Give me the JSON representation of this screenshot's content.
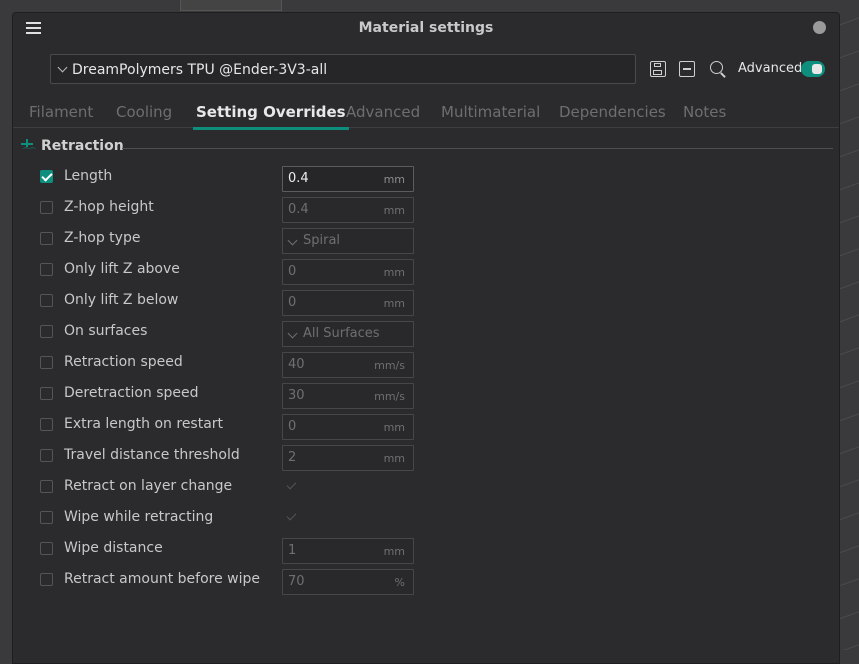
{
  "window": {
    "title": "Material settings"
  },
  "preset": {
    "value": "DreamPolymers  TPU @Ender-3V3-all"
  },
  "toolbar": {
    "advanced_label": "Advanced",
    "advanced_on": true
  },
  "tabs": [
    {
      "label": "Filament",
      "active": false
    },
    {
      "label": "Cooling",
      "active": false
    },
    {
      "label": "Setting Overrides",
      "active": true
    },
    {
      "label": "Advanced",
      "active": false
    },
    {
      "label": "Multimaterial",
      "active": false
    },
    {
      "label": "Dependencies",
      "active": false
    },
    {
      "label": "Notes",
      "active": false
    }
  ],
  "section": {
    "title": "Retraction"
  },
  "rows": [
    {
      "label": "Length",
      "checked": true,
      "kind": "number",
      "value": "0.4",
      "unit": "mm"
    },
    {
      "label": "Z-hop height",
      "checked": false,
      "kind": "number",
      "value": "0.4",
      "unit": "mm"
    },
    {
      "label": "Z-hop type",
      "checked": false,
      "kind": "select",
      "value": "Spiral"
    },
    {
      "label": "Only lift Z above",
      "checked": false,
      "kind": "number",
      "value": "0",
      "unit": "mm"
    },
    {
      "label": "Only lift Z below",
      "checked": false,
      "kind": "number",
      "value": "0",
      "unit": "mm"
    },
    {
      "label": "On surfaces",
      "checked": false,
      "kind": "select",
      "value": "All Surfaces"
    },
    {
      "label": "Retraction speed",
      "checked": false,
      "kind": "number",
      "value": "40",
      "unit": "mm/s"
    },
    {
      "label": "Deretraction speed",
      "checked": false,
      "kind": "number",
      "value": "30",
      "unit": "mm/s"
    },
    {
      "label": "Extra length on restart",
      "checked": false,
      "kind": "number",
      "value": "0",
      "unit": "mm"
    },
    {
      "label": "Travel distance threshold",
      "checked": false,
      "kind": "number",
      "value": "2",
      "unit": "mm"
    },
    {
      "label": "Retract on layer change",
      "checked": false,
      "kind": "bool",
      "value": true
    },
    {
      "label": "Wipe while retracting",
      "checked": false,
      "kind": "bool",
      "value": true
    },
    {
      "label": "Wipe distance",
      "checked": false,
      "kind": "number",
      "value": "1",
      "unit": "mm"
    },
    {
      "label": "Retract amount before wipe",
      "checked": false,
      "kind": "number",
      "value": "70",
      "unit": "%"
    }
  ],
  "colors": {
    "accent": "#0e8f7e",
    "background": "#2b2b2e"
  }
}
